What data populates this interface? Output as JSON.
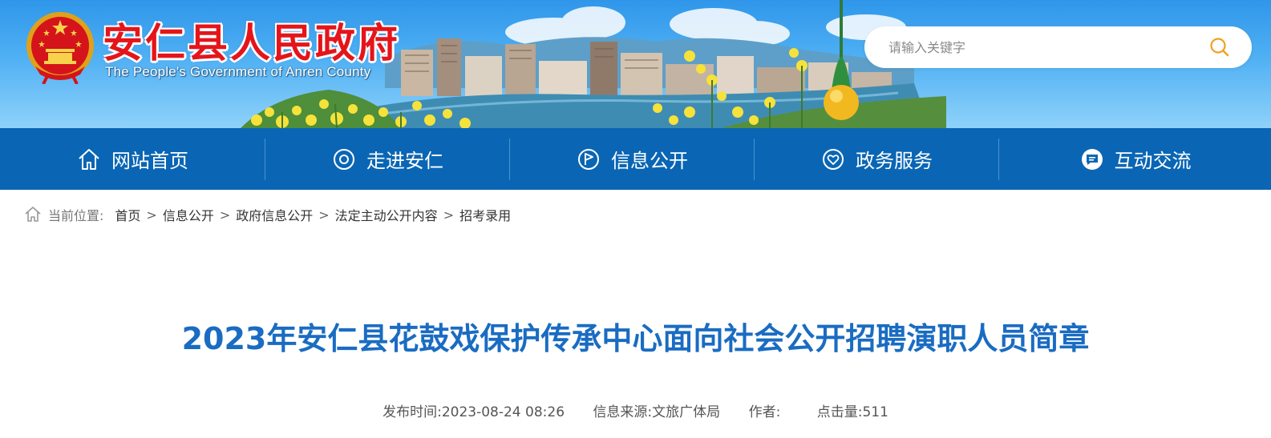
{
  "header": {
    "title_cn": "安仁县人民政府",
    "title_en": "The People's Government of Anren County",
    "search": {
      "placeholder": "请输入关键字"
    }
  },
  "nav": {
    "items": [
      {
        "label": "网站首页",
        "icon": "home-icon"
      },
      {
        "label": "走进安仁",
        "icon": "target-icon"
      },
      {
        "label": "信息公开",
        "icon": "flag-icon"
      },
      {
        "label": "政务服务",
        "icon": "heart-icon"
      },
      {
        "label": "互动交流",
        "icon": "chat-icon"
      }
    ]
  },
  "breadcrumb": {
    "label": "当前位置:",
    "items": [
      "首页",
      "信息公开",
      "政府信息公开",
      "法定主动公开内容",
      "招考录用"
    ],
    "separator": ">"
  },
  "article": {
    "title": "2023年安仁县花鼓戏保护传承中心面向社会公开招聘演职人员简章",
    "meta": {
      "publish_label": "发布时间:",
      "publish_time": "2023-08-24 08:26",
      "source_label": "信息来源:",
      "source": "文旅广体局",
      "author_label": "作者:",
      "author": "",
      "views_label": "点击量:",
      "views": "511"
    }
  },
  "colors": {
    "nav_bg": "#0a66b4",
    "title_red": "#e4151a",
    "article_title_blue": "#1a6cc2",
    "search_icon": "#f0a020"
  }
}
